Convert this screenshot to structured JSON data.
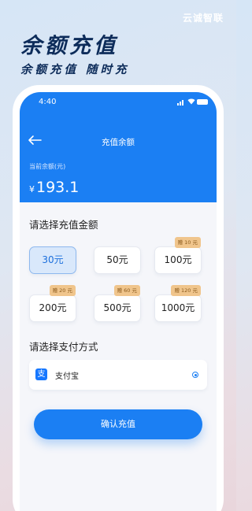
{
  "brand": "云诚智联",
  "hero": {
    "title": "余额充值",
    "subtitle": "余额充值 随时充"
  },
  "status": {
    "time": "4:40"
  },
  "nav": {
    "title": "充值余额"
  },
  "balance": {
    "label": "当前余额(元)",
    "currency": "¥",
    "amount": "193.1"
  },
  "amount_section": {
    "title": "请选择充值金额",
    "options": [
      {
        "label": "30元",
        "gift": "",
        "selected": true
      },
      {
        "label": "50元",
        "gift": "",
        "selected": false
      },
      {
        "label": "100元",
        "gift": "赠 10 元",
        "selected": false
      },
      {
        "label": "200元",
        "gift": "赠 20 元",
        "selected": false
      },
      {
        "label": "500元",
        "gift": "赠 60 元",
        "selected": false
      },
      {
        "label": "1000元",
        "gift": "赠 120 元",
        "selected": false
      }
    ]
  },
  "payment_section": {
    "title": "请选择支付方式",
    "methods": [
      {
        "label": "支付宝",
        "icon": "alipay-icon",
        "selected": true
      }
    ]
  },
  "confirm_label": "确认充值",
  "colors": {
    "accent": "#1b7ff3",
    "gift_bg": "#f0c58c",
    "heading": "#0d2c5a"
  }
}
